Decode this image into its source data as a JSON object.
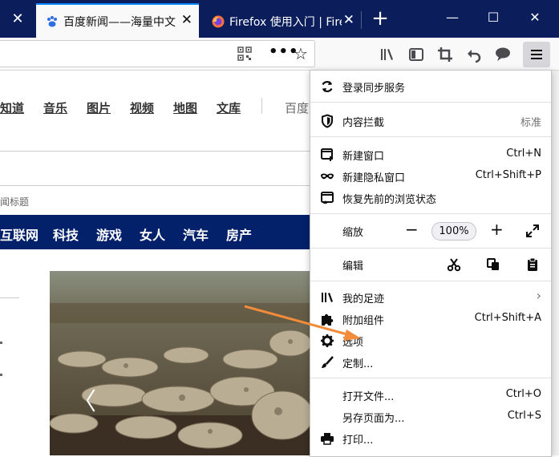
{
  "tabs": [
    {
      "title": "百度新闻——海量中文",
      "close": "✕"
    },
    {
      "title": "Firefox 使用入门 | Firef",
      "close": "✕"
    }
  ],
  "window": {
    "new_tab": "+",
    "minimize": "—",
    "maximize": "☐",
    "close": "✕",
    "left_close": "✕"
  },
  "navbar": {
    "more": "•••",
    "bookmark_star": "☆"
  },
  "page": {
    "nav_links": [
      "知道",
      "音乐",
      "图片",
      "视频",
      "地图",
      "文库",
      "百度"
    ],
    "sub_label": "闻标题",
    "categories": [
      "互联网",
      "科技",
      "游戏",
      "女人",
      "汽车",
      "房产"
    ],
    "carousel_prev": "〈"
  },
  "menu": {
    "sync": {
      "label": "登录同步服务"
    },
    "content_blocking": {
      "label": "内容拦截",
      "value": "标准"
    },
    "new_window": {
      "label": "新建窗口",
      "shortcut": "Ctrl+N"
    },
    "private_window": {
      "label": "新建隐私窗口",
      "shortcut": "Ctrl+Shift+P"
    },
    "restore_session": {
      "label": "恢复先前的浏览状态"
    },
    "zoom": {
      "label": "缩放",
      "minus": "−",
      "value": "100%",
      "plus": "+"
    },
    "edit": {
      "label": "编辑"
    },
    "library": {
      "label": "我的足迹",
      "arrow": "›"
    },
    "addons": {
      "label": "附加组件",
      "shortcut": "Ctrl+Shift+A"
    },
    "options": {
      "label": "选项"
    },
    "customize": {
      "label": "定制..."
    },
    "open_file": {
      "label": "打开文件...",
      "shortcut": "Ctrl+O"
    },
    "save_page": {
      "label": "另存页面为...",
      "shortcut": "Ctrl+S"
    },
    "print": {
      "label": "打印..."
    }
  },
  "colors": {
    "titlebar": "#0b1e5b",
    "accent": "#0a84ff",
    "category_bar": "#03216b",
    "arrow": "#f28c3a"
  }
}
